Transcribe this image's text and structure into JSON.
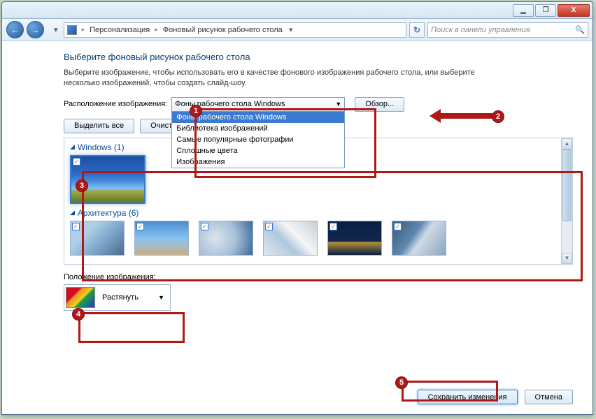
{
  "titlebar": {
    "min": "▁",
    "max": "❐",
    "close": "X"
  },
  "nav": {
    "back": "←",
    "fwd": "→",
    "crumb1": "Персонализация",
    "crumb2": "Фоновый рисунок рабочего стола",
    "search_placeholder": "Поиск в панели управления"
  },
  "heading": "Выберите фоновый рисунок рабочего стола",
  "desc": "Выберите изображение, чтобы использовать его в качестве фонового изображения рабочего стола, или выберите несколько изображений, чтобы создать слайд-шоу.",
  "picloc_label": "Расположение изображения:",
  "combo_selected": "Фоны рабочего стола Windows",
  "combo_options": [
    "Фоны рабочего стола Windows",
    "Библиотека изображений",
    "Самые популярные фотографии",
    "Сплошные цвета",
    "Изображения"
  ],
  "browse": "Обзор...",
  "select_all": "Выделить все",
  "clear_all": "Очисти",
  "categories": {
    "windows": "Windows (1)",
    "arch": "Архитектура (6)"
  },
  "position_label": "Положение изображения:",
  "position_value": "Растянуть",
  "save": "Сохранить изменения",
  "cancel": "Отмена",
  "callouts": {
    "c1": "1",
    "c2": "2",
    "c3": "3",
    "c4": "4",
    "c5": "5"
  }
}
